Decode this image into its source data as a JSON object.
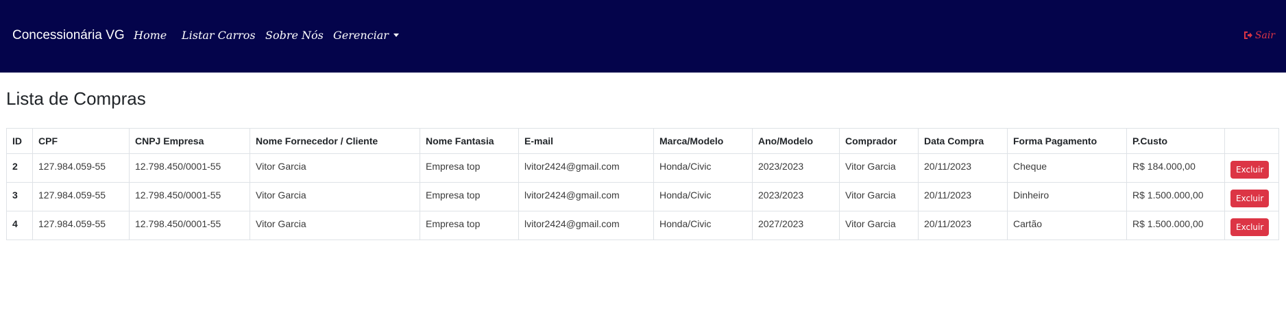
{
  "navbar": {
    "brand": "Concessionária VG",
    "links": [
      {
        "label": "Home"
      },
      {
        "label": "Listar Carros"
      },
      {
        "label": "Sobre Nós"
      },
      {
        "label": "Gerenciar"
      }
    ],
    "logout_label": "Sair",
    "background_color": "#04044b",
    "logout_color": "#dc3545"
  },
  "page": {
    "title": "Lista de Compras"
  },
  "table": {
    "headers": [
      "ID",
      "CPF",
      "CNPJ Empresa",
      "Nome Fornecedor / Cliente",
      "Nome Fantasia",
      "E-mail",
      "Marca/Modelo",
      "Ano/Modelo",
      "Comprador",
      "Data Compra",
      "Forma Pagamento",
      "P.Custo",
      ""
    ],
    "rows": [
      {
        "id": "2",
        "cpf": "127.984.059-55",
        "cnpj": "12.798.450/0001-55",
        "nome": "Vitor Garcia",
        "fantasia": "Empresa top",
        "email": "lvitor2424@gmail.com",
        "marca_modelo": "Honda/Civic",
        "ano_modelo": "2023/2023",
        "comprador": "Vitor Garcia",
        "data_compra": "20/11/2023",
        "forma_pagamento": "Cheque",
        "p_custo": "R$ 184.000,00",
        "action": "Excluir"
      },
      {
        "id": "3",
        "cpf": "127.984.059-55",
        "cnpj": "12.798.450/0001-55",
        "nome": "Vitor Garcia",
        "fantasia": "Empresa top",
        "email": "lvitor2424@gmail.com",
        "marca_modelo": "Honda/Civic",
        "ano_modelo": "2023/2023",
        "comprador": "Vitor Garcia",
        "data_compra": "20/11/2023",
        "forma_pagamento": "Dinheiro",
        "p_custo": "R$ 1.500.000,00",
        "action": "Excluir"
      },
      {
        "id": "4",
        "cpf": "127.984.059-55",
        "cnpj": "12.798.450/0001-55",
        "nome": "Vitor Garcia",
        "fantasia": "Empresa top",
        "email": "lvitor2424@gmail.com",
        "marca_modelo": "Honda/Civic",
        "ano_modelo": "2027/2023",
        "comprador": "Vitor Garcia",
        "data_compra": "20/11/2023",
        "forma_pagamento": "Cartão",
        "p_custo": "R$ 1.500.000,00",
        "action": "Excluir"
      }
    ],
    "action_button_color": "#dc3545"
  }
}
